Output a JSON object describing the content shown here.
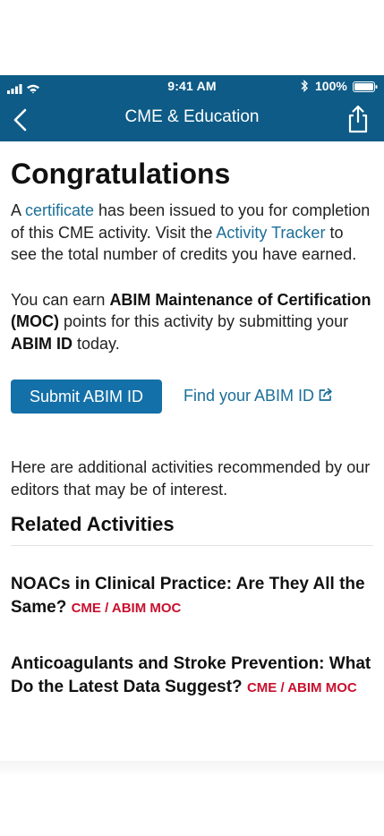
{
  "status_bar": {
    "time": "9:41 AM",
    "battery": "100%"
  },
  "nav": {
    "title": "CME & Education",
    "back_icon": "chevron-left-icon",
    "share_icon": "share-icon"
  },
  "main": {
    "heading": "Congratulations",
    "intro": {
      "p1": "A ",
      "certificate_link": "certificate",
      "p2": " has been issued to you for completion of this CME activity. Visit the ",
      "tracker_link": "Activity Tracker",
      "p3": " to see the total number of credits you have earned."
    },
    "moc": {
      "p1": "You can earn ",
      "bold1": "ABIM Maintenance of Certification (MOC)",
      "p2": " points for this activity by submitting your ",
      "bold2": "ABIM ID",
      "p3": " today."
    },
    "submit_button": "Submit ABIM ID",
    "find_link": "Find your ABIM ID",
    "recommend_text": "Here are additional activities recommended by our editors that may be of interest.",
    "related_heading": "Related Activities",
    "activities": [
      {
        "title": "NOACs in Clinical Practice: Are They All the Same?",
        "tag": "CME / ABIM MOC"
      },
      {
        "title": "Anticoagulants and Stroke Prevention: What Do the Latest Data Suggest?",
        "tag": "CME / ABIM MOC"
      }
    ]
  },
  "colors": {
    "header": "#0d5b86",
    "link": "#1b6f98",
    "button": "#1470a8",
    "tag": "#c8102e"
  }
}
